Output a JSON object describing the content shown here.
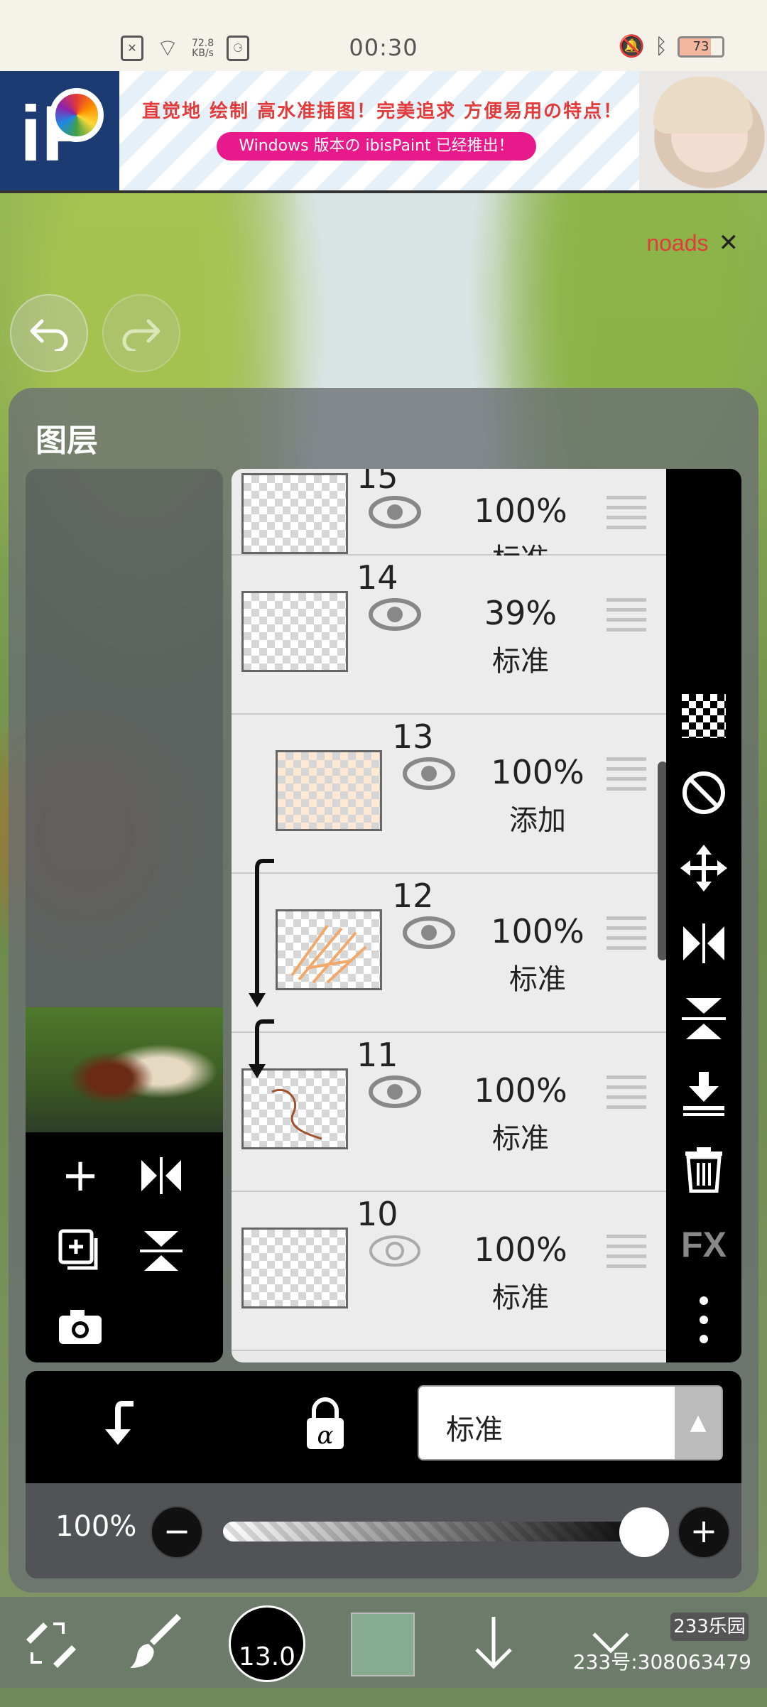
{
  "status_bar": {
    "net_speed_value": "72.8",
    "net_speed_unit": "KB/s",
    "time": "00:30",
    "battery": "73"
  },
  "ad": {
    "headline": "直觉地 绘制 高水准插图！完美追求 方便易用の特点！",
    "pill_text": "Windows 版本の ibisPaint 已经推出！",
    "logo_text": "iP"
  },
  "canvas": {
    "noads_label": "noads",
    "noads_close": "✕",
    "undo_icon": "undo-icon",
    "redo_icon": "redo-icon"
  },
  "layer_panel": {
    "title": "图层",
    "layers": [
      {
        "number": "15",
        "opacity": "100%",
        "blend": "标准",
        "visible": true,
        "clipped": false
      },
      {
        "number": "14",
        "opacity": "39%",
        "blend": "标准",
        "visible": true,
        "clipped": false
      },
      {
        "number": "13",
        "opacity": "100%",
        "blend": "添加",
        "visible": true,
        "clipped": true
      },
      {
        "number": "12",
        "opacity": "100%",
        "blend": "标准",
        "visible": true,
        "clipped": true
      },
      {
        "number": "11",
        "opacity": "100%",
        "blend": "标准",
        "visible": true,
        "clipped": false
      },
      {
        "number": "10",
        "opacity": "100%",
        "blend": "标准",
        "visible": false,
        "clipped": false
      }
    ],
    "side_tools": [
      "checker-icon",
      "circle-half-icon",
      "move-icon",
      "flip-horizontal-icon",
      "flip-vertical-icon",
      "merge-down-icon",
      "trash-icon",
      "fx-icon",
      "more-icon"
    ],
    "fx_label": "FX",
    "preview_tools": [
      "add-layer-icon",
      "flip-h-icon",
      "add-special-layer-icon",
      "flip-v-icon",
      "camera-icon"
    ],
    "blend_mode_selected": "标准",
    "opacity_label": "100%",
    "opacity_value": 1.0
  },
  "tool_bar": {
    "brush_size": "13.0",
    "color": "#86ab90",
    "watermark_logo": "233乐园",
    "watermark_text": "233号:308063479"
  }
}
